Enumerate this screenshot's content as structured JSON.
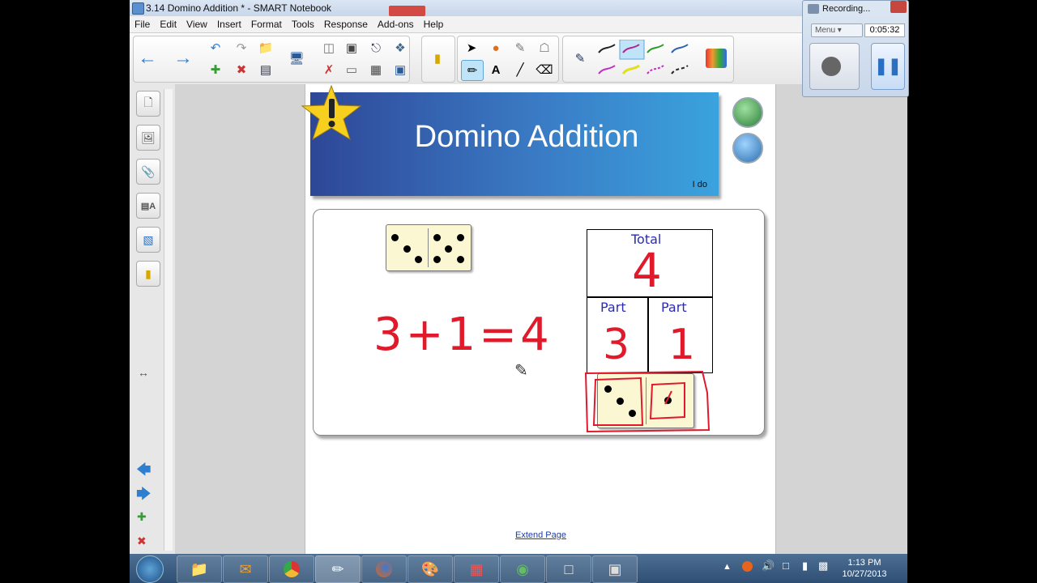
{
  "window": {
    "title": "3.14 Domino Addition * - SMART Notebook"
  },
  "menu": [
    "File",
    "Edit",
    "View",
    "Insert",
    "Format",
    "Tools",
    "Response",
    "Add-ons",
    "Help"
  ],
  "slide": {
    "title": "Domino Addition",
    "subtitle": "I do",
    "equation": "3+1=4",
    "ppm": {
      "total_label": "Total",
      "total_value": "4",
      "part1_label": "Part",
      "part1_value": "3",
      "part2_label": "Part",
      "part2_value": "1"
    },
    "extend_link": "Extend Page"
  },
  "recorder": {
    "status": "Recording...",
    "menu_label": "Menu",
    "time": "0:05:32"
  },
  "taskbar": {
    "time": "1:13 PM",
    "date": "10/27/2013"
  },
  "colors": {
    "banner_start": "#2e4797",
    "banner_end": "#3aa3de",
    "ink_red": "#e01a2a",
    "label_blue": "#2b2bb5",
    "accent_blue": "#2f7fd0"
  }
}
